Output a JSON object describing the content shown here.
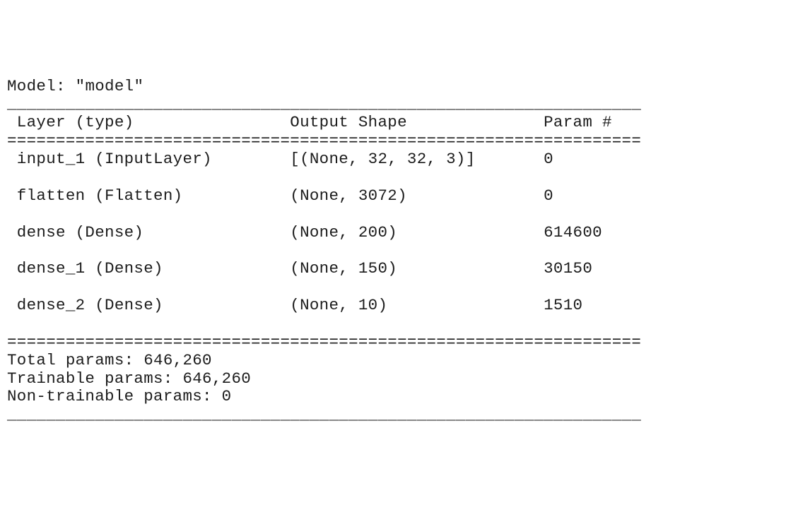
{
  "chart_data": {
    "type": "table",
    "model_name": "model",
    "columns": [
      "Layer (type)",
      "Output Shape",
      "Param #"
    ],
    "rows": [
      {
        "layer": "input_1 (InputLayer)",
        "output_shape": "[(None, 32, 32, 3)]",
        "params": "0"
      },
      {
        "layer": "flatten (Flatten)",
        "output_shape": "(None, 3072)",
        "params": "0"
      },
      {
        "layer": "dense (Dense)",
        "output_shape": "(None, 200)",
        "params": "614600"
      },
      {
        "layer": "dense_1 (Dense)",
        "output_shape": "(None, 150)",
        "params": "30150"
      },
      {
        "layer": "dense_2 (Dense)",
        "output_shape": "(None, 10)",
        "params": "1510"
      }
    ],
    "totals": {
      "total_params": "646,260",
      "trainable_params": "646,260",
      "non_trainable_params": "0"
    }
  },
  "text": {
    "model_label": "Model: ",
    "model_quote_open": "\"",
    "model_quote_close": "\"",
    "col0": "Layer (type)",
    "col1": "Output Shape",
    "col2": "Param #",
    "total_label": "Total params: ",
    "trainable_label": "Trainable params: ",
    "nontrainable_label": "Non-trainable params: "
  },
  "sep": {
    "under": "_________________________________________________________________",
    "equal": "================================================================="
  },
  "widths": {
    "w_layer": 29,
    "w_output": 26
  }
}
